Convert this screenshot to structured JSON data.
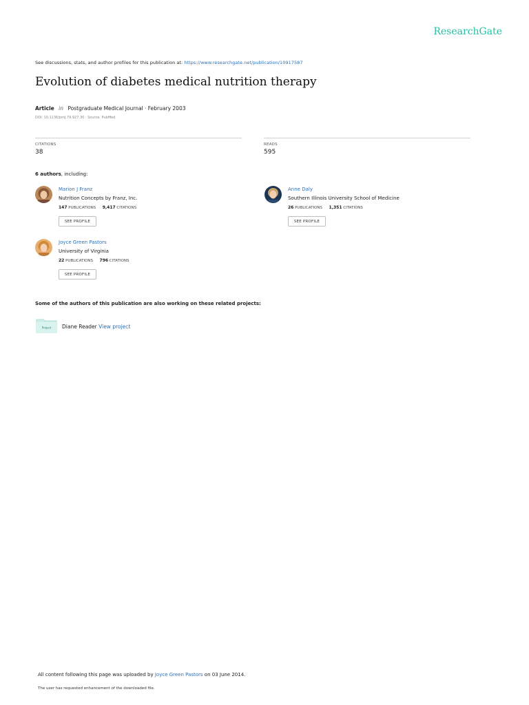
{
  "brand": "ResearchGate",
  "intro": {
    "text": "See discussions, stats, and author profiles for this publication at:",
    "url": "https://www.researchgate.net/publication/10917587"
  },
  "title": "Evolution of diabetes medical nutrition therapy",
  "meta": {
    "type": "Article",
    "in": "in",
    "journal": "Postgraduate Medical Journal · February 2003",
    "doi": "DOI: 10.1136/pmj.79.927.30 · Source: PubMed"
  },
  "stats": {
    "citations_label": "CITATIONS",
    "citations_value": "38",
    "reads_label": "READS",
    "reads_value": "595"
  },
  "authors_heading": {
    "count": "6 authors",
    "suffix": ", including:"
  },
  "authors": [
    {
      "name": "Marion J Franz",
      "institution": "Nutrition Concepts by Franz, Inc.",
      "publications": "147",
      "publications_label": "PUBLICATIONS",
      "citations": "9,417",
      "citations_label": "CITATIONS",
      "button": "SEE PROFILE"
    },
    {
      "name": "Anne Daly",
      "institution": "Southern Illinois University School of Medicine",
      "publications": "26",
      "publications_label": "PUBLICATIONS",
      "citations": "1,351",
      "citations_label": "CITATIONS",
      "button": "SEE PROFILE"
    },
    {
      "name": "Joyce Green Pastors",
      "institution": "University of Virginia",
      "publications": "22",
      "publications_label": "PUBLICATIONS",
      "citations": "796",
      "citations_label": "CITATIONS",
      "button": "SEE PROFILE"
    }
  ],
  "related": {
    "heading": "Some of the authors of this publication are also working on these related projects:",
    "project_name": "Diane Reader",
    "project_link": "View project",
    "project_icon": "Project"
  },
  "footer": {
    "uploaded_prefix": "All content following this page was uploaded by",
    "uploader": "Joyce Green Pastors",
    "uploaded_suffix": "on 03 June 2014.",
    "note": "The user has requested enhancement of the downloaded file."
  },
  "colors": {
    "brand": "#20c1a5",
    "link": "#2f6fb3"
  }
}
